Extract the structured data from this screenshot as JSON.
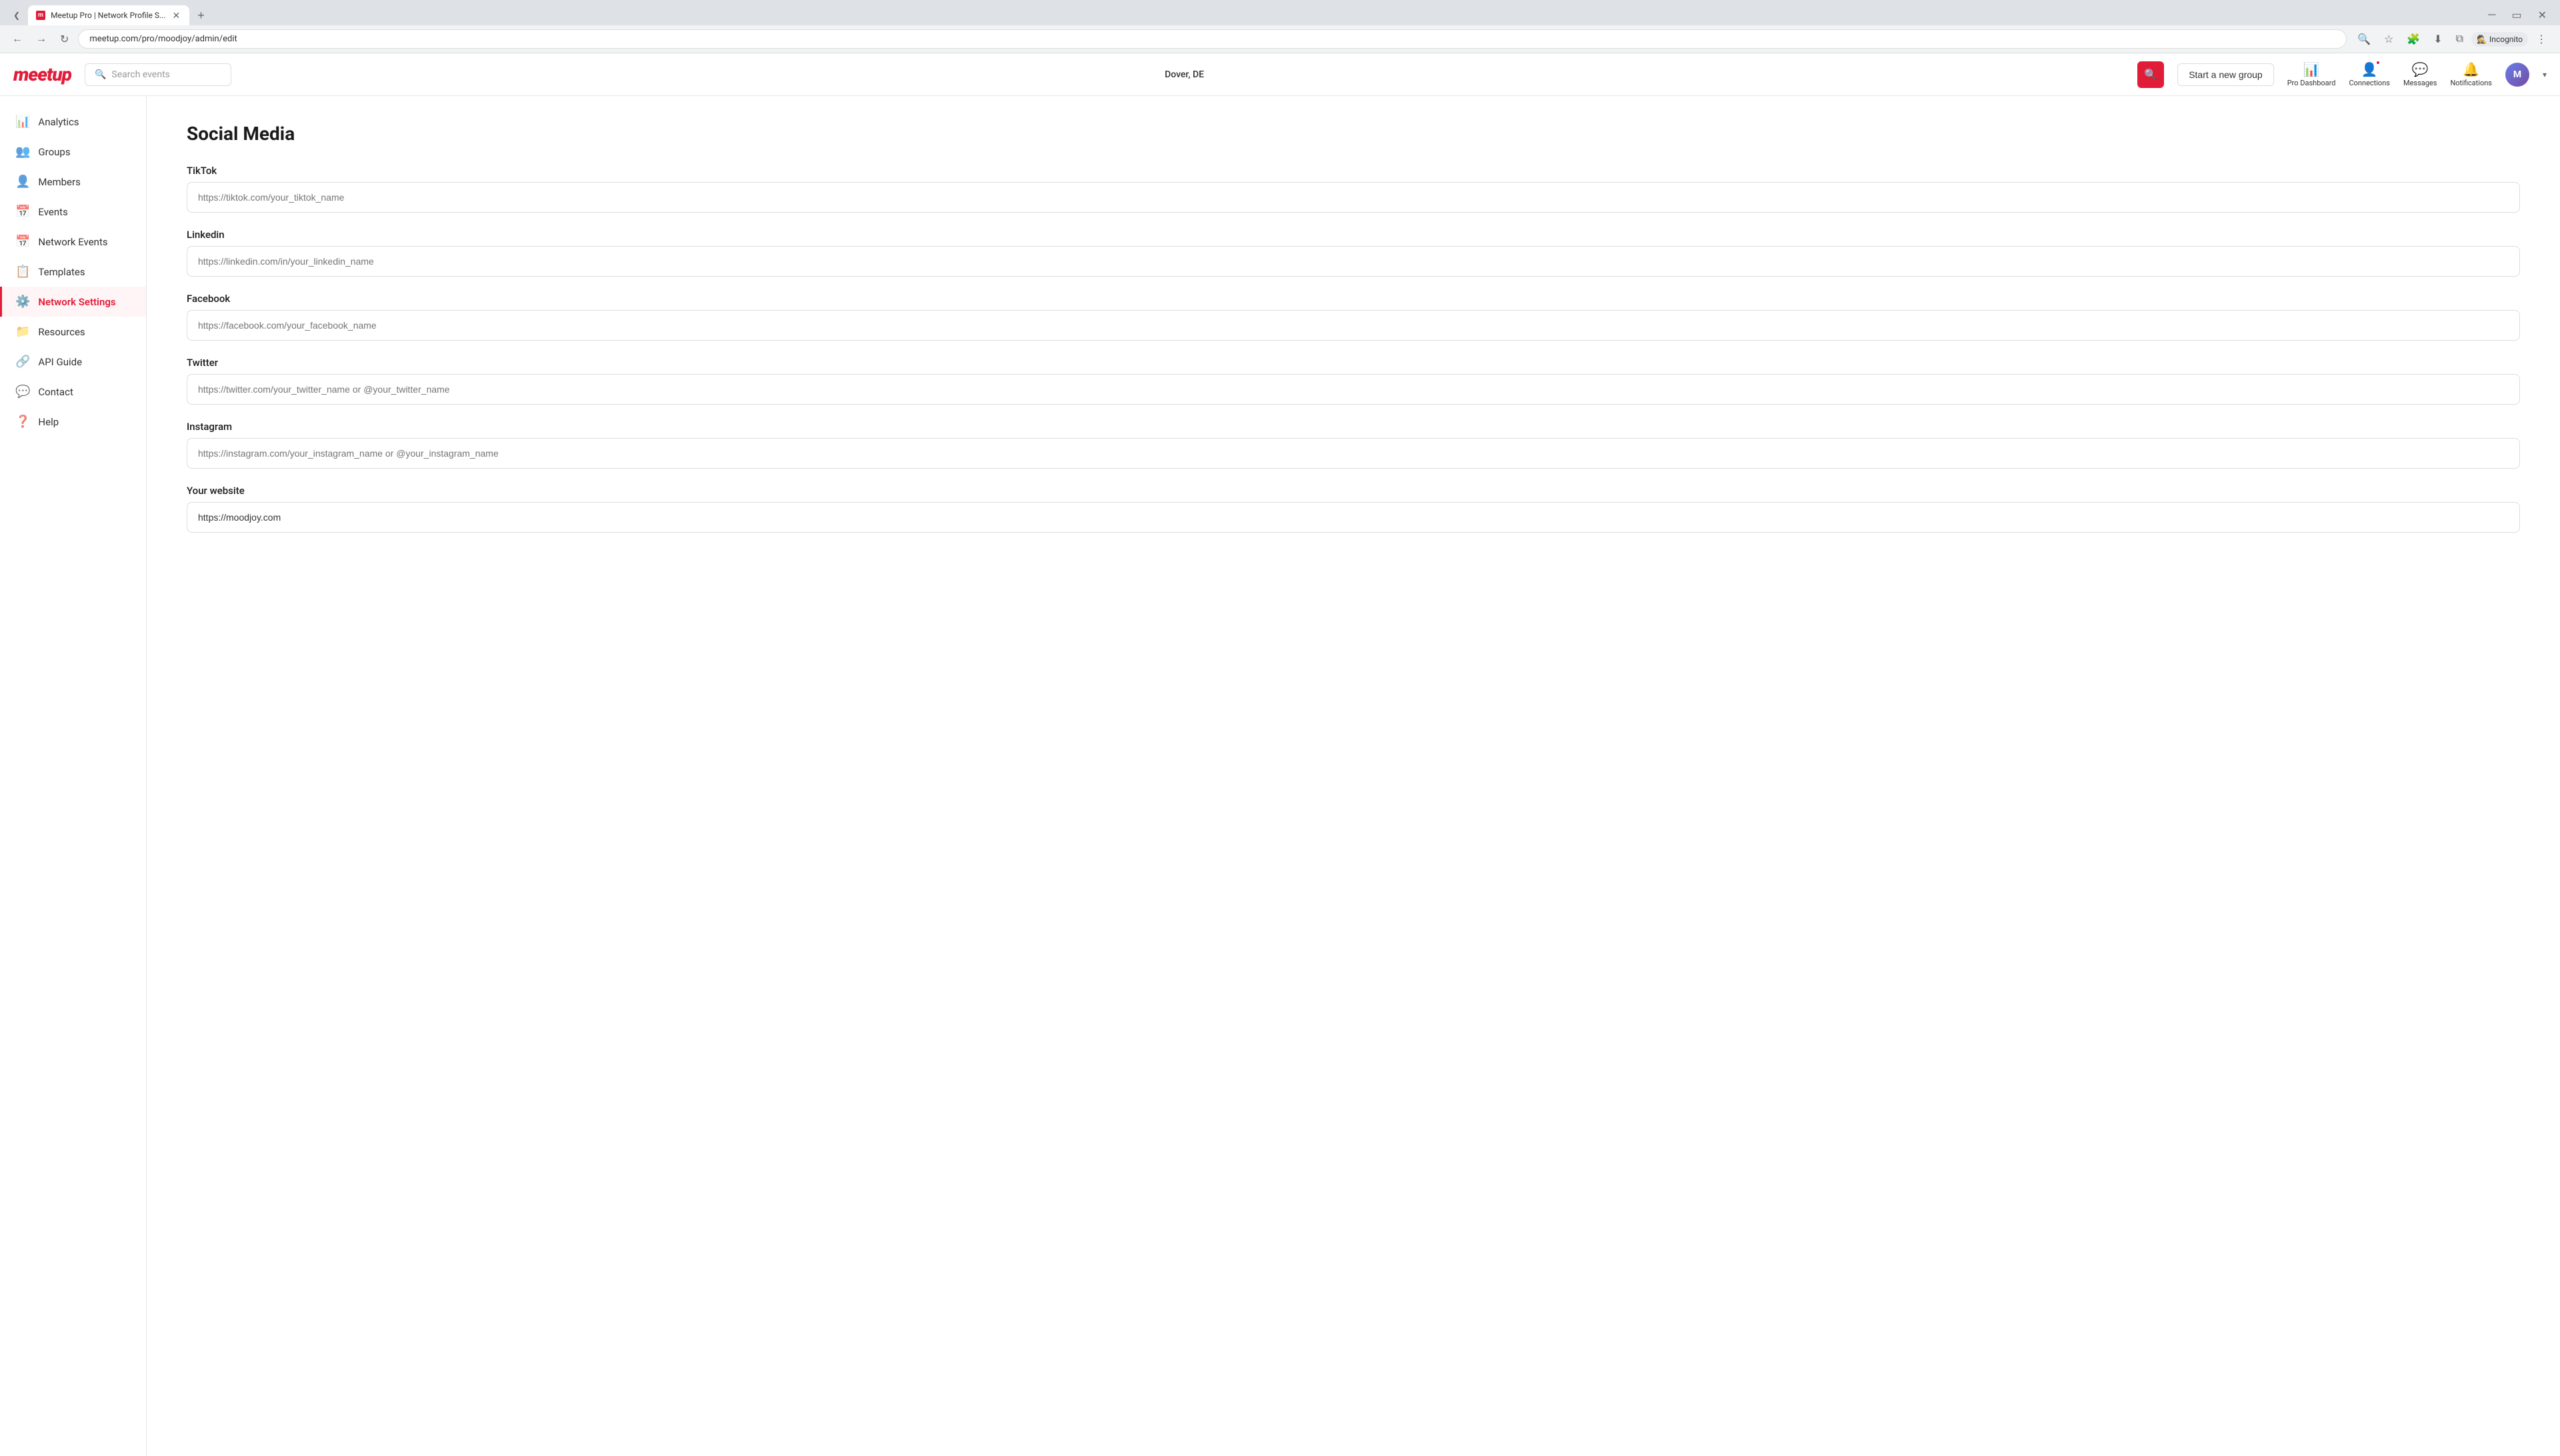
{
  "browser": {
    "tab_title": "Meetup Pro | Network Profile S...",
    "url": "meetup.com/pro/moodjoy/admin/edit",
    "new_tab_label": "+",
    "incognito_label": "Incognito"
  },
  "header": {
    "logo": "meetup",
    "search_placeholder": "Search events",
    "location": "Dover, DE",
    "search_btn_icon": "🔍",
    "new_group_label": "Start a new group",
    "nav": {
      "pro_dashboard": "Pro Dashboard",
      "connections": "Connections",
      "messages": "Messages",
      "notifications": "Notifications"
    }
  },
  "sidebar": {
    "items": [
      {
        "id": "analytics",
        "label": "Analytics",
        "icon": "📊"
      },
      {
        "id": "groups",
        "label": "Groups",
        "icon": "👥"
      },
      {
        "id": "members",
        "label": "Members",
        "icon": "👤"
      },
      {
        "id": "events",
        "label": "Events",
        "icon": "📅"
      },
      {
        "id": "network-events",
        "label": "Network Events",
        "icon": "📅"
      },
      {
        "id": "templates",
        "label": "Templates",
        "icon": "📋"
      },
      {
        "id": "network-settings",
        "label": "Network Settings",
        "icon": "⚙️",
        "active": true
      },
      {
        "id": "resources",
        "label": "Resources",
        "icon": "📁"
      },
      {
        "id": "api-guide",
        "label": "API Guide",
        "icon": "🔗"
      },
      {
        "id": "contact",
        "label": "Contact",
        "icon": "💬"
      },
      {
        "id": "help",
        "label": "Help",
        "icon": "❓"
      }
    ]
  },
  "main": {
    "page_title": "Social Media",
    "fields": [
      {
        "id": "tiktok",
        "label": "TikTok",
        "placeholder": "https://tiktok.com/your_tiktok_name",
        "value": ""
      },
      {
        "id": "linkedin",
        "label": "Linkedin",
        "placeholder": "https://linkedin.com/in/your_linkedin_name",
        "value": ""
      },
      {
        "id": "facebook",
        "label": "Facebook",
        "placeholder": "https://facebook.com/your_facebook_name",
        "value": ""
      },
      {
        "id": "twitter",
        "label": "Twitter",
        "placeholder": "https://twitter.com/your_twitter_name or @your_twitter_name",
        "value": ""
      },
      {
        "id": "instagram",
        "label": "Instagram",
        "placeholder": "https://instagram.com/your_instagram_name or @your_instagram_name",
        "value": ""
      },
      {
        "id": "website",
        "label": "Your website",
        "placeholder": "",
        "value": "https://moodjoy.com"
      }
    ]
  }
}
